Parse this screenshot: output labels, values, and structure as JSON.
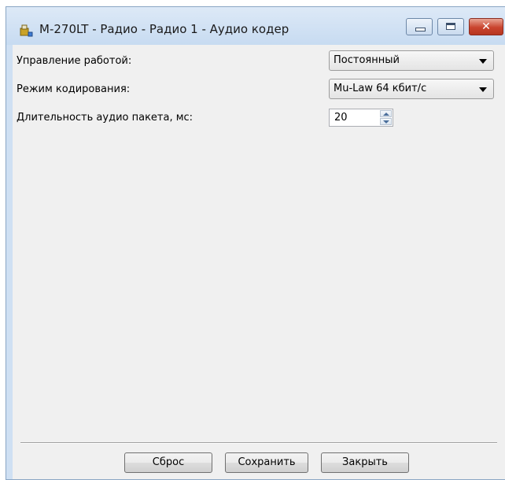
{
  "window": {
    "title": "M-270LT - Радио - Радио 1 - Аудио кодер",
    "close_glyph": "✕"
  },
  "form": {
    "work_control": {
      "label": "Управление работой:",
      "value": "Постоянный"
    },
    "encoding_mode": {
      "label": "Режим кодирования:",
      "value": "Mu-Law 64 кбит/с"
    },
    "packet_duration": {
      "label": "Длительность аудио пакета, мс:",
      "value": "20"
    }
  },
  "buttons": {
    "reset": "Сброс",
    "save": "Сохранить",
    "close": "Закрыть"
  }
}
